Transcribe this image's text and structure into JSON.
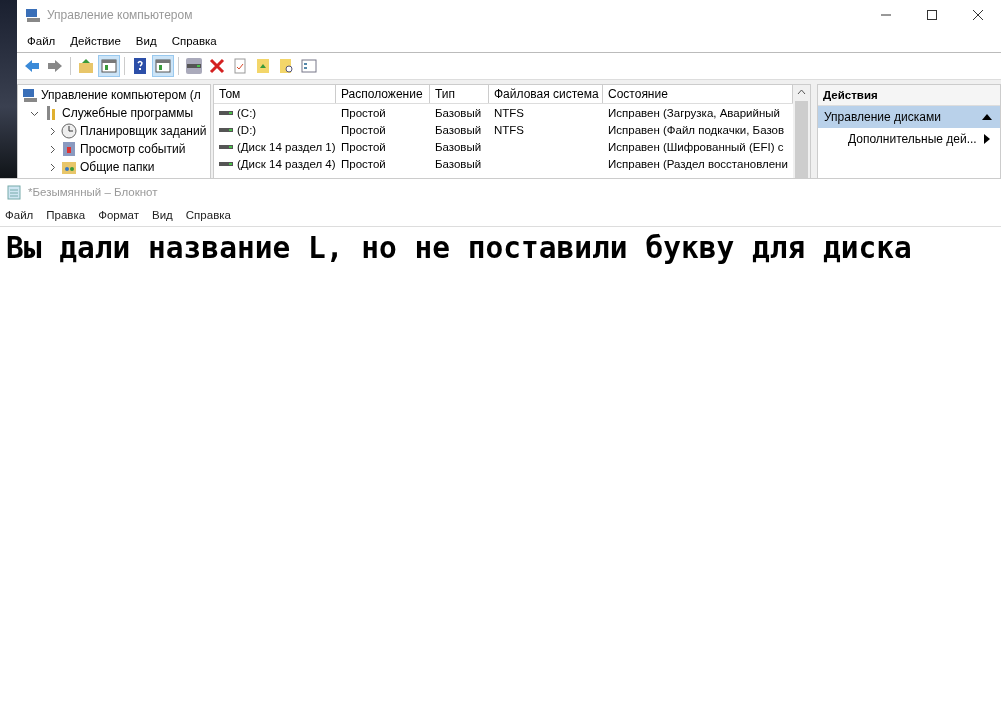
{
  "mmc": {
    "title": "Управление компьютером",
    "menu": [
      "Файл",
      "Действие",
      "Вид",
      "Справка"
    ],
    "toolbar": [
      {
        "kind": "back",
        "pressed": false
      },
      {
        "kind": "forward",
        "pressed": false
      },
      {
        "kind": "sep"
      },
      {
        "kind": "up",
        "pressed": false
      },
      {
        "kind": "pane",
        "pressed": true
      },
      {
        "kind": "sep"
      },
      {
        "kind": "help",
        "pressed": false
      },
      {
        "kind": "pane",
        "pressed": true
      },
      {
        "kind": "sep"
      },
      {
        "kind": "drive",
        "pressed": false
      },
      {
        "kind": "delete",
        "pressed": false
      },
      {
        "kind": "doc",
        "pressed": false
      },
      {
        "kind": "folder-up",
        "pressed": false
      },
      {
        "kind": "folder-search",
        "pressed": false
      },
      {
        "kind": "list",
        "pressed": false
      }
    ],
    "tree": [
      {
        "label": "Управление компьютером (л",
        "kind": "computer",
        "children": [
          {
            "label": "Служебные программы",
            "kind": "tools",
            "expanded": true,
            "children": [
              {
                "label": "Планировщик заданий",
                "kind": "clock",
                "expanded": false
              },
              {
                "label": "Просмотр событий",
                "kind": "log",
                "expanded": false
              },
              {
                "label": "Общие папки",
                "kind": "share",
                "expanded": false
              }
            ]
          }
        ]
      }
    ],
    "table": {
      "columns": [
        "Том",
        "Расположение",
        "Тип",
        "Файловая система",
        "Состояние"
      ],
      "rows": [
        [
          "(C:)",
          "Простой",
          "Базовый",
          "NTFS",
          "Исправен (Загрузка, Аварийный"
        ],
        [
          "(D:)",
          "Простой",
          "Базовый",
          "NTFS",
          "Исправен (Файл подкачки, Базов"
        ],
        [
          "(Диск 14 раздел 1)",
          "Простой",
          "Базовый",
          "",
          "Исправен (Шифрованный (EFI) с"
        ],
        [
          "(Диск 14 раздел 4)",
          "Простой",
          "Базовый",
          "",
          "Исправен (Раздел восстановлени"
        ]
      ]
    },
    "actions": {
      "title": "Действия",
      "items": [
        {
          "label": "Управление дисками",
          "selected": true
        },
        {
          "label": "Дополнительные дей...",
          "selected": false
        }
      ]
    }
  },
  "notepad": {
    "title": "*Безымянный – Блокнот",
    "menu": [
      "Файл",
      "Правка",
      "Формат",
      "Вид",
      "Справка"
    ],
    "text": "Вы дали название L, но не поставили букву для диска"
  }
}
